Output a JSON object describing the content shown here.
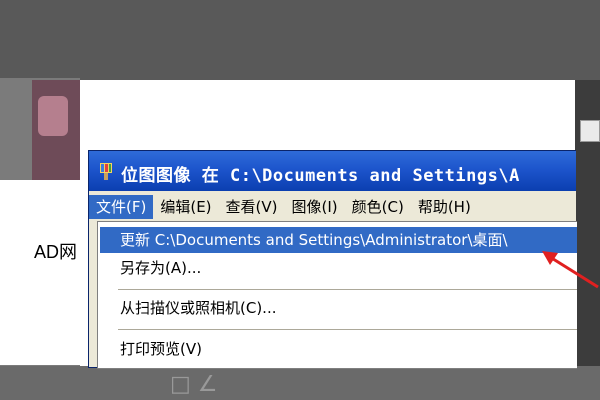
{
  "background": {
    "left_text": "AD网"
  },
  "window": {
    "title": "位图图像 在 C:\\Documents and Settings\\A"
  },
  "menubar": {
    "items": [
      {
        "label": "文件(F)",
        "active": true
      },
      {
        "label": "编辑(E)"
      },
      {
        "label": "查看(V)"
      },
      {
        "label": "图像(I)"
      },
      {
        "label": "颜色(C)"
      },
      {
        "label": "帮助(H)"
      }
    ]
  },
  "file_menu": {
    "items": [
      {
        "label": "更新 C:\\Documents and Settings\\Administrator\\桌面\\",
        "highlighted": true
      },
      {
        "label": "另存为(A)..."
      },
      {
        "label": "从扫描仪或照相机(C)..."
      },
      {
        "label": "打印预览(V)"
      }
    ]
  },
  "colors": {
    "titlebar": "#1d55cc",
    "menu_highlight": "#316ac5",
    "menu_bg": "#ece9d8",
    "arrow": "#e02020"
  },
  "icons": [
    "paint-brush-icon",
    "red-arrow-annotation"
  ]
}
